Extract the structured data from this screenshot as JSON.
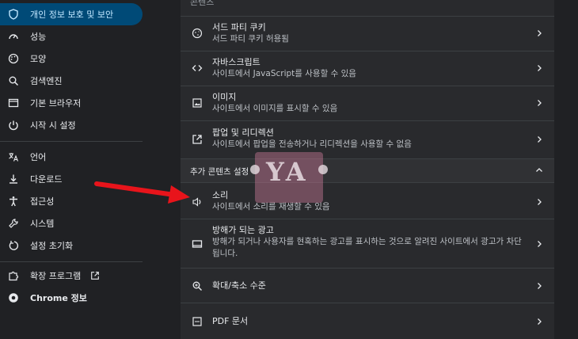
{
  "sidebar": {
    "items": [
      {
        "label": "개인 정보 보호 및 보안",
        "icon": "shield-icon"
      },
      {
        "label": "성능",
        "icon": "speedometer-icon"
      },
      {
        "label": "모양",
        "icon": "palette-icon"
      },
      {
        "label": "검색엔진",
        "icon": "search-icon"
      },
      {
        "label": "기본 브라우저",
        "icon": "browser-window-icon"
      },
      {
        "label": "시작 시 설정",
        "icon": "power-icon"
      },
      {
        "label": "언어",
        "icon": "translate-icon"
      },
      {
        "label": "다운로드",
        "icon": "download-icon"
      },
      {
        "label": "접근성",
        "icon": "accessibility-icon"
      },
      {
        "label": "시스템",
        "icon": "wrench-icon"
      },
      {
        "label": "설정 초기화",
        "icon": "reset-icon"
      },
      {
        "label": "확장 프로그램",
        "icon": "puzzle-icon"
      },
      {
        "label": "Chrome 정보",
        "icon": "chrome-icon"
      }
    ]
  },
  "main": {
    "top_heading": "콘텐츠",
    "rows": [
      {
        "title": "서드 파티 쿠키",
        "desc": "서드 파티 쿠키 허용됨",
        "icon": "cookie-icon"
      },
      {
        "title": "자바스크립트",
        "desc": "사이트에서 JavaScript를 사용할 수 있음",
        "icon": "code-icon"
      },
      {
        "title": "이미지",
        "desc": "사이트에서 이미지를 표시할 수 있음",
        "icon": "image-icon"
      },
      {
        "title": "팝업 및 리디렉션",
        "desc": "사이트에서 팝업을 전송하거나 리디렉션을 사용할 수 없음",
        "icon": "external-link-icon"
      }
    ],
    "additional_heading": "추가 콘텐츠 설정",
    "additional_rows": [
      {
        "title": "소리",
        "desc": "사이트에서 소리를 재생할 수 있음",
        "icon": "speaker-icon"
      },
      {
        "title": "방해가 되는 광고",
        "desc": "방해가 되거나 사용자를 현혹하는 광고를 표시하는 것으로 알려진 사이트에서 광고가 차단됩니다.",
        "icon": "ad-window-icon"
      },
      {
        "title": "확대/축소 수준",
        "desc": "",
        "icon": "zoom-icon"
      },
      {
        "title": "PDF 문서",
        "desc": "",
        "icon": "pdf-icon"
      }
    ]
  },
  "watermark": {
    "text": "YA"
  },
  "colors": {
    "accent": "#004a77",
    "background": "#202124",
    "panel": "#292a2d",
    "arrow": "#e8141b"
  }
}
